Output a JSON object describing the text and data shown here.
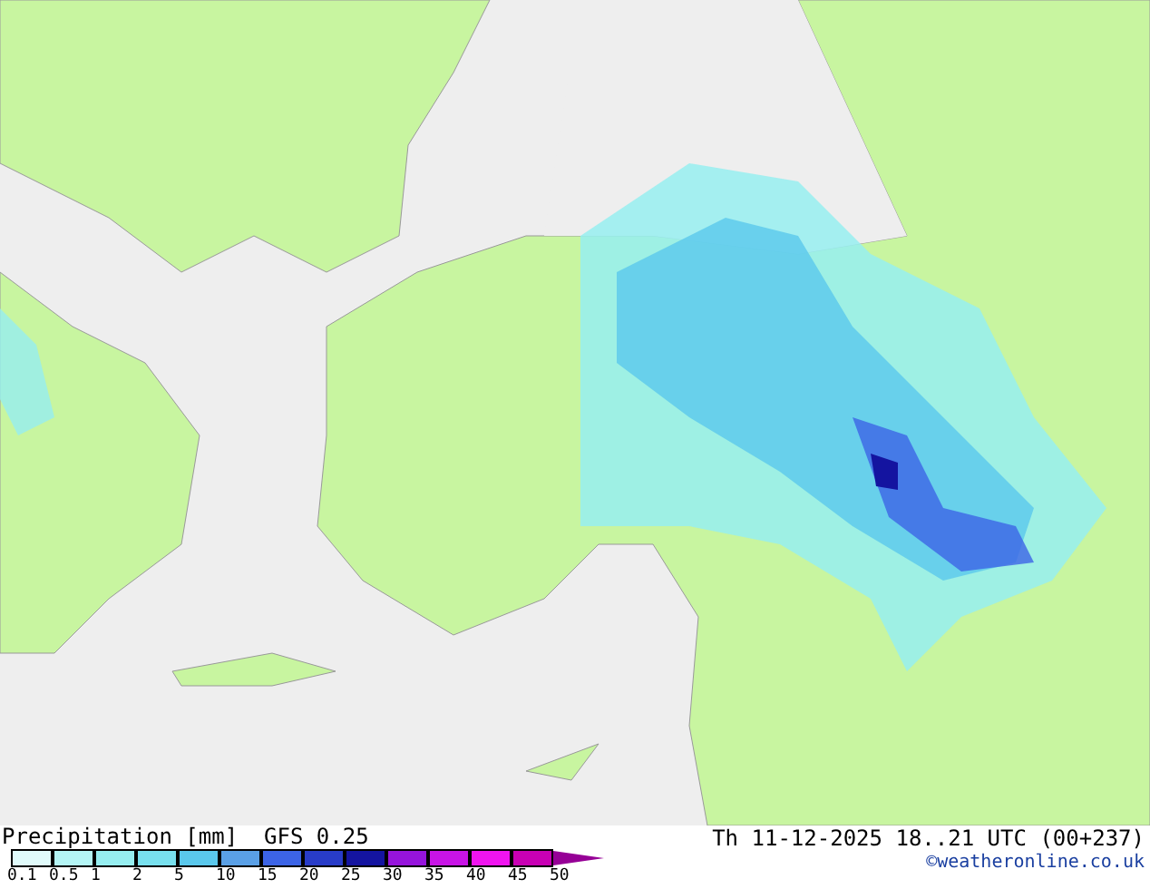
{
  "title": "Precipitation [mm]",
  "model": "GFS 0.25",
  "valid_time": "Th 11-12-2025 18..21 UTC (00+237)",
  "legend": [
    {
      "label": "0.1",
      "color": "#e0fafa"
    },
    {
      "label": "0.5",
      "color": "#b4f5f5"
    },
    {
      "label": "1",
      "color": "#96eef0"
    },
    {
      "label": "2",
      "color": "#78e0ee"
    },
    {
      "label": "5",
      "color": "#5ac8ec"
    },
    {
      "label": "10",
      "color": "#5aa0e6"
    },
    {
      "label": "15",
      "color": "#3c64e6"
    },
    {
      "label": "20",
      "color": "#283cc8"
    },
    {
      "label": "25",
      "color": "#1414a0"
    },
    {
      "label": "30",
      "color": "#9614dc"
    },
    {
      "label": "35",
      "color": "#c814e6"
    },
    {
      "label": "40",
      "color": "#f014f0"
    },
    {
      "label": "45",
      "color": "#c800b4"
    }
  ],
  "legend_end": "50",
  "copyright": "©weatheronline.co.uk"
}
